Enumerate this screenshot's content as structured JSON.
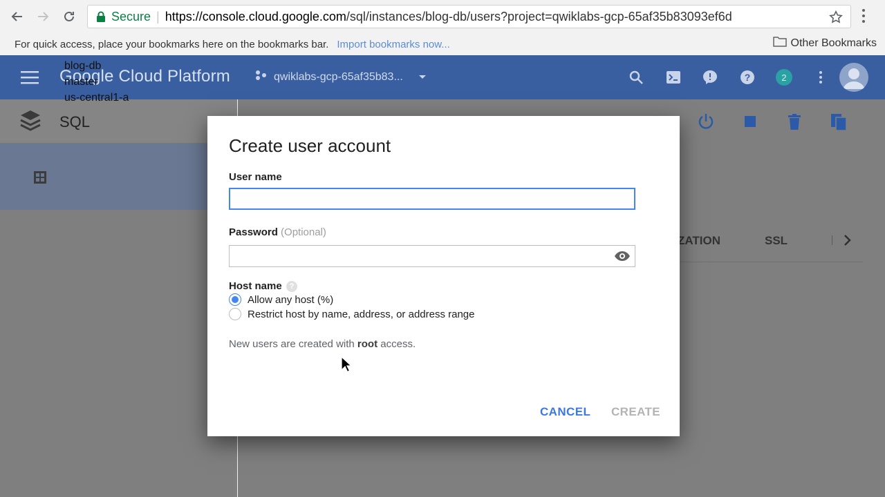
{
  "browser": {
    "secure_label": "Secure",
    "url_base": "https://console.cloud.google.com",
    "url_path": "/sql/instances/blog-db/users?project=qwiklabs-gcp-65af35b83093ef6d",
    "bookmarks_hint": "For quick access, place your bookmarks here on the bookmarks bar.",
    "import_link": "Import bookmarks now...",
    "other_bookmarks": "Other Bookmarks"
  },
  "header": {
    "brand": "Google Cloud Platform",
    "project": "qwiklabs-gcp-65af35b83...",
    "notification_count": "2"
  },
  "sidebar": {
    "title": "SQL",
    "instance": {
      "name": "blog-db",
      "role": "master",
      "zone": "us-central1-a"
    }
  },
  "tabs": {
    "partial": "ZATION",
    "ssl": "SSL"
  },
  "dialog": {
    "title": "Create user account",
    "username_label": "User name",
    "username_value": "",
    "password_label": "Password",
    "password_optional": "(Optional)",
    "password_value": "",
    "host_label": "Host name",
    "host_options": [
      {
        "label": "Allow any host (%)",
        "checked": true
      },
      {
        "label": "Restrict host by name, address, or address range",
        "checked": false
      }
    ],
    "note_prefix": "New users are created with ",
    "note_bold": "root",
    "note_suffix": " access.",
    "cancel": "CANCEL",
    "create": "CREATE"
  },
  "colors": {
    "accent": "#4285f4",
    "secure": "#0b8043",
    "header": "#3a5fa0"
  }
}
